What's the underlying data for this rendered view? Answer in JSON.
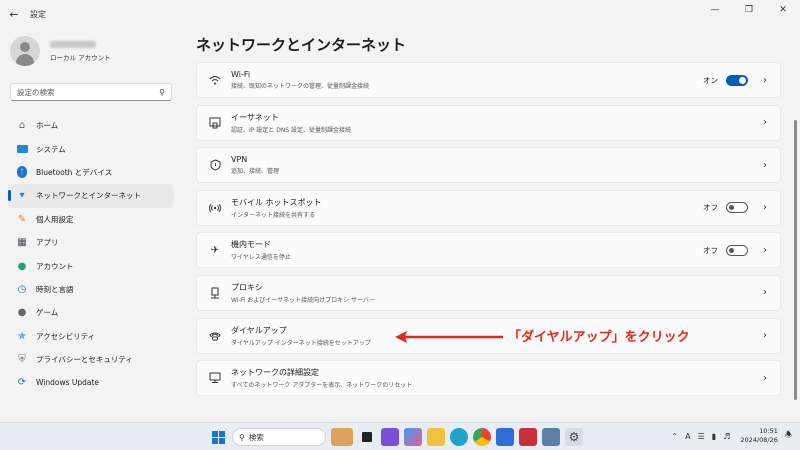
{
  "window": {
    "title": "設定",
    "back_icon": "back-arrow-icon",
    "controls": [
      "minimize",
      "maximize",
      "close"
    ]
  },
  "profile": {
    "account_type": "ローカル アカウント"
  },
  "search": {
    "placeholder": "設定の検索"
  },
  "sidebar": {
    "items": [
      {
        "label": "ホーム",
        "icon": "home-icon",
        "active": false
      },
      {
        "label": "システム",
        "icon": "system-icon",
        "active": false
      },
      {
        "label": "Bluetooth とデバイス",
        "icon": "bluetooth-icon",
        "active": false
      },
      {
        "label": "ネットワークとインターネット",
        "icon": "network-icon",
        "active": true
      },
      {
        "label": "個人用設定",
        "icon": "personalization-icon",
        "active": false
      },
      {
        "label": "アプリ",
        "icon": "apps-icon",
        "active": false
      },
      {
        "label": "アカウント",
        "icon": "accounts-icon",
        "active": false
      },
      {
        "label": "時刻と言語",
        "icon": "time-language-icon",
        "active": false
      },
      {
        "label": "ゲーム",
        "icon": "gaming-icon",
        "active": false
      },
      {
        "label": "アクセシビリティ",
        "icon": "accessibility-icon",
        "active": false
      },
      {
        "label": "プライバシーとセキュリティ",
        "icon": "privacy-icon",
        "active": false
      },
      {
        "label": "Windows Update",
        "icon": "windows-update-icon",
        "active": false
      }
    ]
  },
  "main": {
    "title": "ネットワークとインターネット",
    "cards": [
      {
        "title": "Wi-Fi",
        "desc": "接続、既知のネットワークの管理、従量制課金接続",
        "icon": "wifi-icon",
        "state": "オン",
        "toggle": "on"
      },
      {
        "title": "イーサネット",
        "desc": "認証、IP 設定と DNS 設定、従量制課金接続",
        "icon": "ethernet-icon",
        "state": "",
        "toggle": "none"
      },
      {
        "title": "VPN",
        "desc": "追加、接続、管理",
        "icon": "vpn-shield-icon",
        "state": "",
        "toggle": "none"
      },
      {
        "title": "モバイル ホットスポット",
        "desc": "インターネット接続を共有する",
        "icon": "hotspot-icon",
        "state": "オフ",
        "toggle": "off"
      },
      {
        "title": "機内モード",
        "desc": "ワイヤレス通信を停止",
        "icon": "airplane-icon",
        "state": "オフ",
        "toggle": "off"
      },
      {
        "title": "プロキシ",
        "desc": "Wi-Fi およびイーサネット接続向けプロキシ サーバー",
        "icon": "proxy-icon",
        "state": "",
        "toggle": "none"
      },
      {
        "title": "ダイヤルアップ",
        "desc": "ダイヤルアップ インターネット接続をセットアップ",
        "icon": "dialup-icon",
        "state": "",
        "toggle": "none"
      },
      {
        "title": "ネットワークの詳細設定",
        "desc": "すべてのネットワーク アダプターを表示、ネットワークのリセット",
        "icon": "advanced-network-icon",
        "state": "",
        "toggle": "none"
      }
    ]
  },
  "annotation": {
    "text": "「ダイヤルアップ」をクリック",
    "color": "#e8241b"
  },
  "taskbar": {
    "search_label": "検索",
    "time": "10:51",
    "date": "2024/08/26",
    "ime": "A",
    "apps": [
      "start-icon",
      "search-icon",
      "widget-icon",
      "task-view-icon",
      "copilot-icon",
      "photos-icon",
      "file-explorer-icon",
      "edge-icon",
      "chrome-icon",
      "store-icon",
      "app-icon",
      "snipping-icon",
      "settings-icon"
    ]
  },
  "colors": {
    "accent": "#005fb8",
    "background": "#f3f3f3",
    "card": "#fbfbfb"
  }
}
